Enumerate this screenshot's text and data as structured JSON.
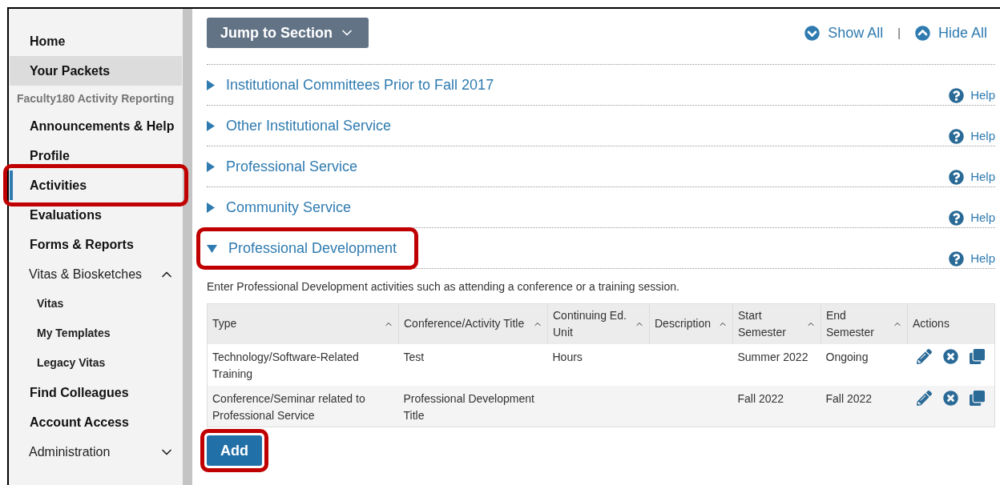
{
  "sidebar": {
    "items": [
      {
        "kind": "link",
        "label": "Home",
        "selected": false,
        "hovered": false,
        "annotated": false
      },
      {
        "kind": "link",
        "label": "Your Packets",
        "selected": false,
        "hovered": true,
        "annotated": false
      },
      {
        "kind": "caption",
        "label": "Faculty180 Activity Reporting"
      },
      {
        "kind": "link",
        "label": "Announcements & Help",
        "selected": false,
        "hovered": false,
        "annotated": false
      },
      {
        "kind": "link",
        "label": "Profile",
        "selected": false,
        "hovered": false,
        "annotated": false
      },
      {
        "kind": "link",
        "label": "Activities",
        "selected": true,
        "hovered": false,
        "annotated": true
      },
      {
        "kind": "link",
        "label": "Evaluations",
        "selected": false,
        "hovered": false,
        "annotated": false
      },
      {
        "kind": "link",
        "label": "Forms & Reports",
        "selected": false,
        "hovered": false,
        "annotated": false
      },
      {
        "kind": "group",
        "label": "Vitas & Biosketches",
        "expanded": true,
        "children": [
          {
            "label": "Vitas"
          },
          {
            "label": "My Templates"
          },
          {
            "label": "Legacy Vitas"
          }
        ]
      },
      {
        "kind": "link",
        "label": "Find Colleagues",
        "selected": false,
        "hovered": false,
        "annotated": false
      },
      {
        "kind": "link",
        "label": "Account Access",
        "selected": false,
        "hovered": false,
        "annotated": false
      },
      {
        "kind": "group",
        "label": "Administration",
        "expanded": false
      }
    ]
  },
  "toolbar": {
    "jump_button": "Jump to Section",
    "show_all": "Show All",
    "separator": "|",
    "hide_all": "Hide All"
  },
  "sections": [
    {
      "title": "Institutional Committees Prior to Fall 2017",
      "expanded": false,
      "annotated": false,
      "help": "Help"
    },
    {
      "title": "Other Institutional Service",
      "expanded": false,
      "annotated": false,
      "help": "Help"
    },
    {
      "title": "Professional Service",
      "expanded": false,
      "annotated": false,
      "help": "Help"
    },
    {
      "title": "Community Service",
      "expanded": false,
      "annotated": false,
      "help": "Help"
    },
    {
      "title": "Professional Development",
      "expanded": true,
      "annotated": true,
      "help": "Help",
      "description": "Enter Professional Development activities such as attending a conference or a training session.",
      "table": {
        "columns": [
          {
            "label": "Type",
            "sortable": true
          },
          {
            "label": "Conference/Activity Title",
            "sortable": true
          },
          {
            "label": "Continuing Ed. Unit",
            "sortable": true
          },
          {
            "label": "Description",
            "sortable": true
          },
          {
            "label": "Start Semester",
            "sortable": true
          },
          {
            "label": "End Semester",
            "sortable": true
          },
          {
            "label": "Actions",
            "sortable": false
          }
        ],
        "rows": [
          [
            "Technology/Software-Related Training",
            "Test",
            "Hours",
            "",
            "Summer 2022",
            "Ongoing"
          ],
          [
            "Conference/Seminar related to Professional Service",
            "Professional Development Title",
            "",
            "",
            "Fall 2022",
            "Fall 2022"
          ]
        ]
      },
      "add_button": {
        "label": "Add",
        "annotated": true
      }
    }
  ]
}
